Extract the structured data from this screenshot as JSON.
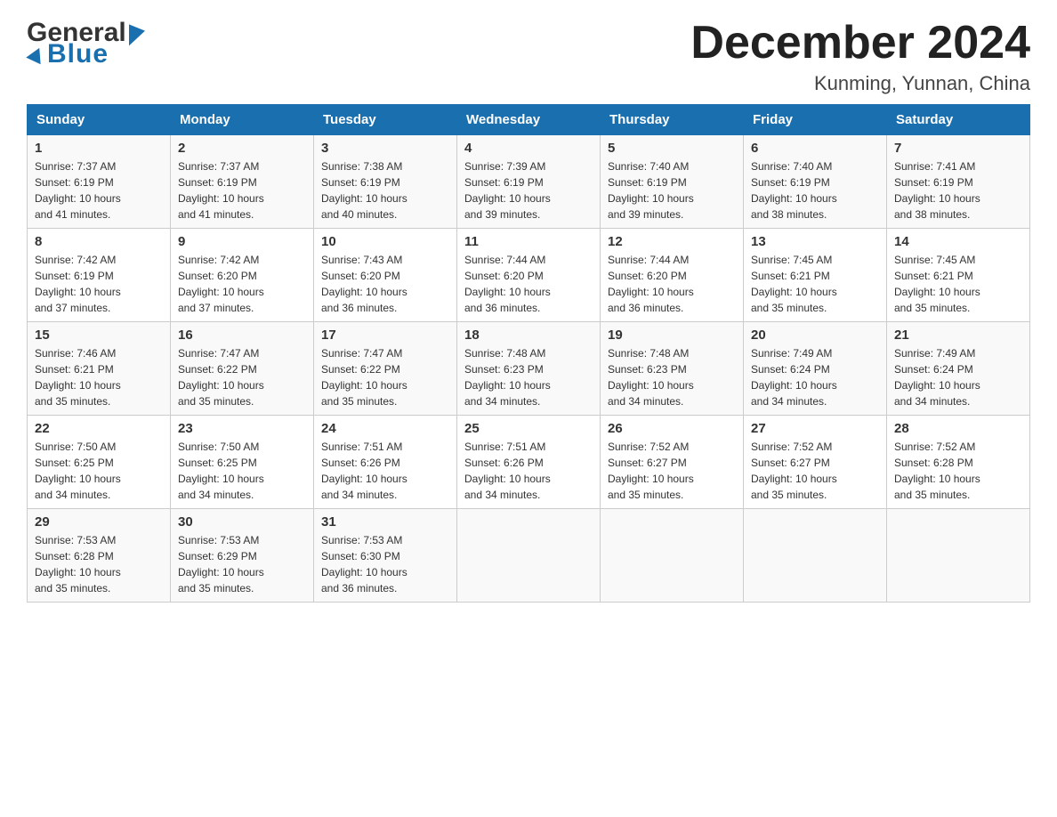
{
  "header": {
    "month_title": "December 2024",
    "location": "Kunming, Yunnan, China",
    "logo_general": "General",
    "logo_blue": "Blue"
  },
  "columns": [
    "Sunday",
    "Monday",
    "Tuesday",
    "Wednesday",
    "Thursday",
    "Friday",
    "Saturday"
  ],
  "weeks": [
    [
      {
        "day": "1",
        "sunrise": "7:37 AM",
        "sunset": "6:19 PM",
        "daylight": "10 hours and 41 minutes."
      },
      {
        "day": "2",
        "sunrise": "7:37 AM",
        "sunset": "6:19 PM",
        "daylight": "10 hours and 41 minutes."
      },
      {
        "day": "3",
        "sunrise": "7:38 AM",
        "sunset": "6:19 PM",
        "daylight": "10 hours and 40 minutes."
      },
      {
        "day": "4",
        "sunrise": "7:39 AM",
        "sunset": "6:19 PM",
        "daylight": "10 hours and 39 minutes."
      },
      {
        "day": "5",
        "sunrise": "7:40 AM",
        "sunset": "6:19 PM",
        "daylight": "10 hours and 39 minutes."
      },
      {
        "day": "6",
        "sunrise": "7:40 AM",
        "sunset": "6:19 PM",
        "daylight": "10 hours and 38 minutes."
      },
      {
        "day": "7",
        "sunrise": "7:41 AM",
        "sunset": "6:19 PM",
        "daylight": "10 hours and 38 minutes."
      }
    ],
    [
      {
        "day": "8",
        "sunrise": "7:42 AM",
        "sunset": "6:19 PM",
        "daylight": "10 hours and 37 minutes."
      },
      {
        "day": "9",
        "sunrise": "7:42 AM",
        "sunset": "6:20 PM",
        "daylight": "10 hours and 37 minutes."
      },
      {
        "day": "10",
        "sunrise": "7:43 AM",
        "sunset": "6:20 PM",
        "daylight": "10 hours and 36 minutes."
      },
      {
        "day": "11",
        "sunrise": "7:44 AM",
        "sunset": "6:20 PM",
        "daylight": "10 hours and 36 minutes."
      },
      {
        "day": "12",
        "sunrise": "7:44 AM",
        "sunset": "6:20 PM",
        "daylight": "10 hours and 36 minutes."
      },
      {
        "day": "13",
        "sunrise": "7:45 AM",
        "sunset": "6:21 PM",
        "daylight": "10 hours and 35 minutes."
      },
      {
        "day": "14",
        "sunrise": "7:45 AM",
        "sunset": "6:21 PM",
        "daylight": "10 hours and 35 minutes."
      }
    ],
    [
      {
        "day": "15",
        "sunrise": "7:46 AM",
        "sunset": "6:21 PM",
        "daylight": "10 hours and 35 minutes."
      },
      {
        "day": "16",
        "sunrise": "7:47 AM",
        "sunset": "6:22 PM",
        "daylight": "10 hours and 35 minutes."
      },
      {
        "day": "17",
        "sunrise": "7:47 AM",
        "sunset": "6:22 PM",
        "daylight": "10 hours and 35 minutes."
      },
      {
        "day": "18",
        "sunrise": "7:48 AM",
        "sunset": "6:23 PM",
        "daylight": "10 hours and 34 minutes."
      },
      {
        "day": "19",
        "sunrise": "7:48 AM",
        "sunset": "6:23 PM",
        "daylight": "10 hours and 34 minutes."
      },
      {
        "day": "20",
        "sunrise": "7:49 AM",
        "sunset": "6:24 PM",
        "daylight": "10 hours and 34 minutes."
      },
      {
        "day": "21",
        "sunrise": "7:49 AM",
        "sunset": "6:24 PM",
        "daylight": "10 hours and 34 minutes."
      }
    ],
    [
      {
        "day": "22",
        "sunrise": "7:50 AM",
        "sunset": "6:25 PM",
        "daylight": "10 hours and 34 minutes."
      },
      {
        "day": "23",
        "sunrise": "7:50 AM",
        "sunset": "6:25 PM",
        "daylight": "10 hours and 34 minutes."
      },
      {
        "day": "24",
        "sunrise": "7:51 AM",
        "sunset": "6:26 PM",
        "daylight": "10 hours and 34 minutes."
      },
      {
        "day": "25",
        "sunrise": "7:51 AM",
        "sunset": "6:26 PM",
        "daylight": "10 hours and 34 minutes."
      },
      {
        "day": "26",
        "sunrise": "7:52 AM",
        "sunset": "6:27 PM",
        "daylight": "10 hours and 35 minutes."
      },
      {
        "day": "27",
        "sunrise": "7:52 AM",
        "sunset": "6:27 PM",
        "daylight": "10 hours and 35 minutes."
      },
      {
        "day": "28",
        "sunrise": "7:52 AM",
        "sunset": "6:28 PM",
        "daylight": "10 hours and 35 minutes."
      }
    ],
    [
      {
        "day": "29",
        "sunrise": "7:53 AM",
        "sunset": "6:28 PM",
        "daylight": "10 hours and 35 minutes."
      },
      {
        "day": "30",
        "sunrise": "7:53 AM",
        "sunset": "6:29 PM",
        "daylight": "10 hours and 35 minutes."
      },
      {
        "day": "31",
        "sunrise": "7:53 AM",
        "sunset": "6:30 PM",
        "daylight": "10 hours and 36 minutes."
      },
      null,
      null,
      null,
      null
    ]
  ],
  "labels": {
    "sunrise": "Sunrise:",
    "sunset": "Sunset:",
    "daylight": "Daylight:"
  }
}
